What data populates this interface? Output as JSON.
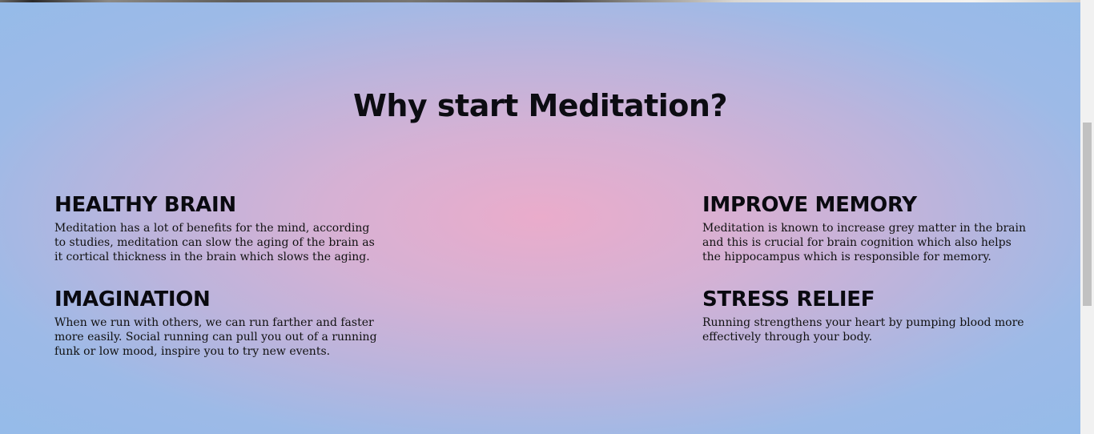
{
  "section": {
    "title": "Why start Meditation?"
  },
  "features": [
    {
      "heading": "HEALTHY BRAIN",
      "text": "Meditation has a lot of benefits for the mind, according to studies, meditation can slow the aging of the brain as it cortical thickness in the brain which slows the aging."
    },
    {
      "heading": "IMPROVE MEMORY",
      "text": "Meditation is known to increase grey matter in the brain and this is crucial for brain cognition which also helps the hippocampus which is responsible for memory."
    },
    {
      "heading": "IMAGINATION",
      "text": "When we run with others, we can run farther and faster more easily. Social running can pull you out of a running funk or low mood, inspire you to try new events."
    },
    {
      "heading": "STRESS RELIEF",
      "text": "Running strengthens your heart by pumping blood more effectively through your body."
    }
  ],
  "colors": {
    "gradient_center": "#eaaccb",
    "gradient_edge": "#95bbe9",
    "heading_text": "#0c0c12"
  }
}
